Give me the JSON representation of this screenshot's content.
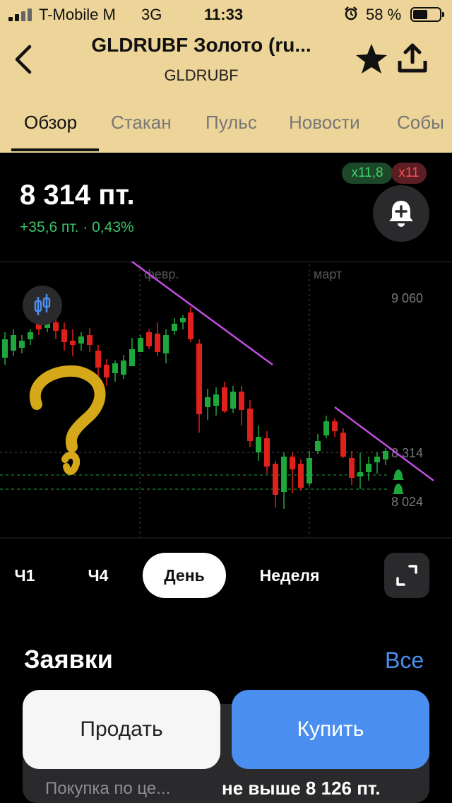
{
  "status_bar": {
    "carrier": "T-Mobile M",
    "network": "3G",
    "time": "11:33",
    "battery_percent": "58 %",
    "icons": [
      "signal-icon",
      "alarm-icon",
      "battery-icon"
    ]
  },
  "header": {
    "title": "GLDRUBF Золото (ru...",
    "ticker": "GLDRUBF",
    "icons": [
      "back-icon",
      "star-icon",
      "share-icon"
    ]
  },
  "tabs": [
    {
      "label": "Обзор",
      "active": true
    },
    {
      "label": "Стакан",
      "active": false
    },
    {
      "label": "Пульс",
      "active": false
    },
    {
      "label": "Новости",
      "active": false
    },
    {
      "label": "Собы",
      "active": false
    }
  ],
  "quote": {
    "price": "8 314 пт.",
    "change": "+35,6 пт. · 0,43%",
    "badge_green": "x11,8",
    "badge_red": "x11"
  },
  "chart": {
    "month_labels": [
      "февр.",
      "март"
    ],
    "price_labels": [
      "9 060",
      "8 314",
      "8 024"
    ],
    "colors": {
      "up": "#1ea83c",
      "down": "#e0201b",
      "trend": "#c04ee0",
      "level": "#1ea83c"
    }
  },
  "periods": [
    {
      "label": "Ч1",
      "active": false
    },
    {
      "label": "Ч4",
      "active": false
    },
    {
      "label": "День",
      "active": true
    },
    {
      "label": "Неделя",
      "active": false
    }
  ],
  "orders": {
    "title": "Заявки",
    "all_link": "Все",
    "sell_label": "Продать",
    "buy_label": "Купить",
    "limit_label": "Покупка по це...",
    "limit_value": "не выше 8 126 пт."
  }
}
